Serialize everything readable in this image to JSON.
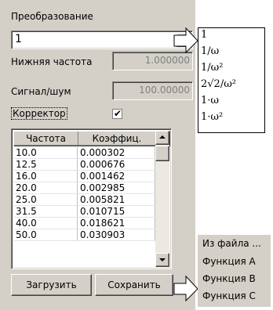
{
  "transform": {
    "label": "Преобразование",
    "value": "1",
    "options": [
      "1",
      "1/ω",
      "1/ω²",
      "2√2/ω²",
      "1·ω",
      "1·ω²"
    ]
  },
  "low_freq": {
    "label": "Нижняя частота",
    "value": "1.000000"
  },
  "snr": {
    "label": "Сигнал/шум",
    "value": "100.00000"
  },
  "corrector": {
    "label": "Корректор",
    "checked": true,
    "check_glyph": "✔"
  },
  "table": {
    "headers": [
      "Частота",
      "Коэффиц."
    ],
    "rows": [
      [
        "10.0",
        "0.000302"
      ],
      [
        "12.5",
        "0.000676"
      ],
      [
        "16.0",
        "0.001462"
      ],
      [
        "20.0",
        "0.002985"
      ],
      [
        "25.0",
        "0.005821"
      ],
      [
        "31.5",
        "0.010715"
      ],
      [
        "40.0",
        "0.018621"
      ],
      [
        "50.0",
        "0.030903"
      ]
    ]
  },
  "buttons": {
    "load": "Загрузить",
    "save": "Сохранить"
  },
  "load_menu": {
    "items": [
      "Из файла ...",
      "Функция A",
      "Функция B",
      "Функция C"
    ]
  },
  "colors": {
    "panel": "#d4d0c8",
    "disabled_text": "#808080"
  }
}
